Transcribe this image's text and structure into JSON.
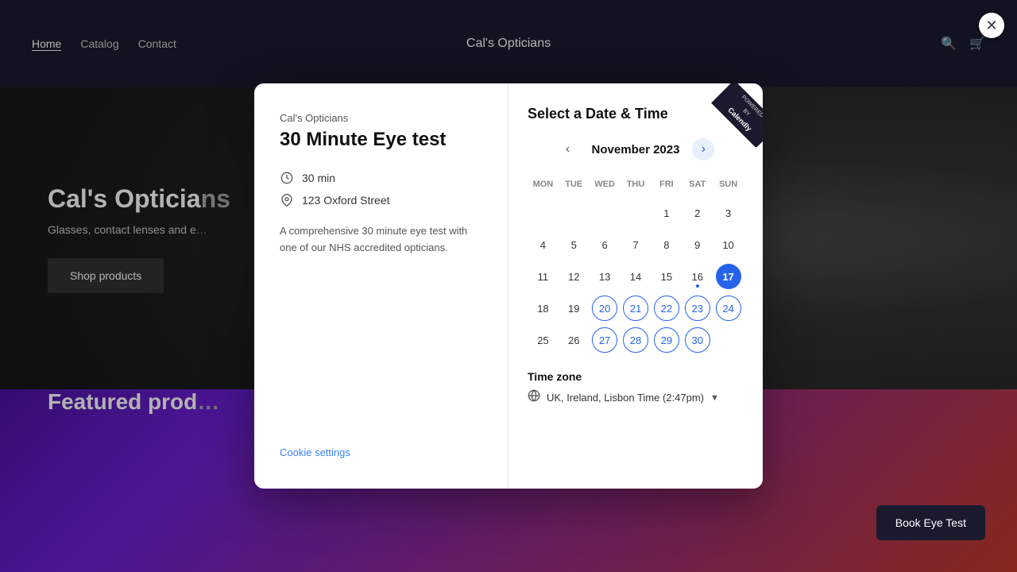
{
  "nav": {
    "links": [
      {
        "label": "Home",
        "active": true
      },
      {
        "label": "Catalog",
        "active": false
      },
      {
        "label": "Contact",
        "active": false
      }
    ],
    "brand": "Cal's Opticians",
    "search_icon": "🔍",
    "cart_icon": "🛒"
  },
  "hero": {
    "title": "Cal's Opticia…",
    "subtitle": "Glasses, contact lenses and e…",
    "cta": "Shop products"
  },
  "featured": {
    "heading": "Featured prod…"
  },
  "modal": {
    "brand": "Cal's Opticians",
    "title": "30 Minute Eye test",
    "duration": "30 min",
    "location": "123 Oxford Street",
    "description": "A comprehensive 30 minute eye test with one of our NHS accredited opticians.",
    "cookie_settings": "Cookie settings",
    "calendar_title": "Select a Date & Time",
    "month": "November 2023",
    "days_of_week": [
      "MON",
      "TUE",
      "WED",
      "THU",
      "FRI",
      "SAT",
      "SUN"
    ],
    "weeks": [
      [
        null,
        null,
        null,
        null,
        "1",
        "2",
        "3"
      ],
      [
        "4",
        null,
        null,
        null,
        "5",
        "6",
        "7",
        "8",
        "9",
        "10",
        "11",
        "12"
      ],
      [
        "13",
        "14",
        "15",
        "16",
        "17",
        "18",
        "19"
      ],
      [
        "20",
        "21",
        "22",
        "23",
        "24",
        "25",
        "26"
      ],
      [
        "27",
        "28",
        "29",
        "30",
        null,
        null,
        null
      ]
    ],
    "available_dates": [
      "17",
      "20",
      "21",
      "22",
      "23",
      "24",
      "27",
      "28",
      "29",
      "30"
    ],
    "today": "17",
    "has_dot": "16",
    "timezone_label": "Time zone",
    "timezone": "UK, Ireland, Lisbon Time (2:47pm)",
    "powered_by": "POWERED BY",
    "powered_brand": "Calendly",
    "book_btn": "Book Eye Test",
    "close_icon": "✕"
  },
  "calendar_grid": {
    "row1": [
      {
        "day": "",
        "type": "empty"
      },
      {
        "day": "",
        "type": "empty"
      },
      {
        "day": "",
        "type": "empty"
      },
      {
        "day": "",
        "type": "empty"
      },
      {
        "day": "1",
        "type": "normal"
      },
      {
        "day": "2",
        "type": "normal"
      },
      {
        "day": "3",
        "type": "normal"
      }
    ],
    "row2": [
      {
        "day": "4",
        "type": "normal"
      },
      {
        "day": "5",
        "type": "normal"
      },
      {
        "day": "6",
        "type": "normal"
      },
      {
        "day": "7",
        "type": "normal"
      },
      {
        "day": "8",
        "type": "normal"
      },
      {
        "day": "9",
        "type": "normal"
      },
      {
        "day": "10",
        "type": "normal"
      }
    ],
    "row3": [
      {
        "day": "11",
        "type": "normal"
      },
      {
        "day": "12",
        "type": "normal"
      },
      {
        "day": "13",
        "type": "normal"
      },
      {
        "day": "14",
        "type": "normal"
      },
      {
        "day": "15",
        "type": "normal"
      },
      {
        "day": "16",
        "type": "dot"
      },
      {
        "day": "17",
        "type": "today"
      },
      {
        "day": "18",
        "type": "normal"
      },
      {
        "day": "19",
        "type": "normal"
      }
    ]
  }
}
